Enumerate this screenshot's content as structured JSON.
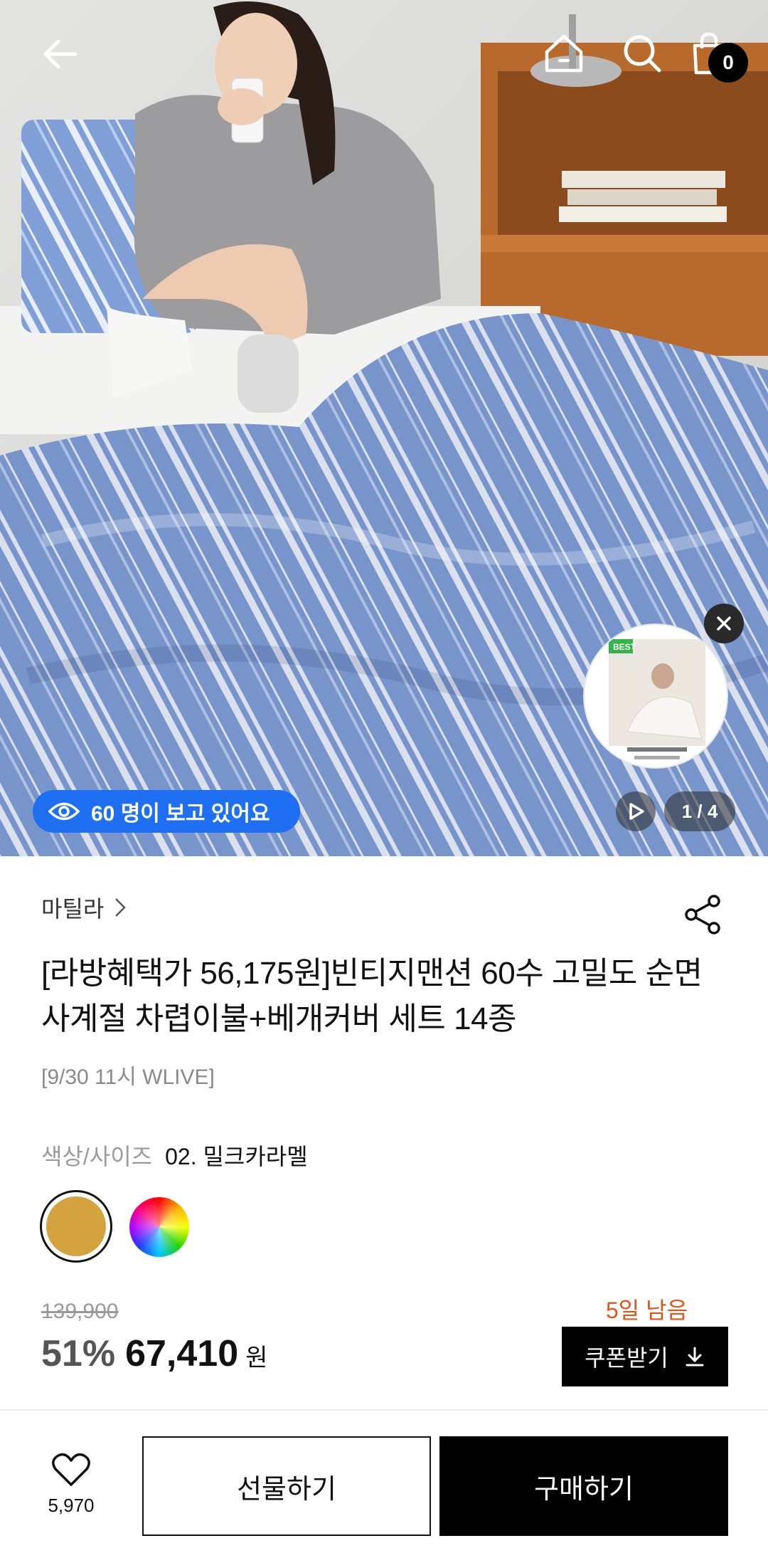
{
  "header": {
    "back_icon": "arrow-left-icon",
    "home_icon": "home-icon",
    "search_icon": "search-icon",
    "cart_icon": "shopping-bag-icon",
    "cart_count": "0"
  },
  "hero": {
    "viewers_text": "60 명이 보고 있어요",
    "viewers_icon": "eye-icon",
    "page_indicator": "1 / 4",
    "live_thumb_badge": "BEST",
    "accent_color": "#1f6ff2"
  },
  "product": {
    "brand": "마틸라",
    "title": "[라방혜택가 56,175원]빈티지맨션 60수 고밀도 순면 사계절 차렵이불+베개커버 세트 14종",
    "subtitle": "[9/30 11시 WLIVE]",
    "option_label": "색상/사이즈",
    "option_value": "02. 밀크카라멜",
    "swatch_selected_color": "#d4a23f",
    "original_price": "139,900",
    "discount": "51%",
    "sale_price": "67,410",
    "currency": "원",
    "days_left": "5일 남음",
    "coupon_label": "쿠폰받기"
  },
  "bottom": {
    "wish_count": "5,970",
    "gift_label": "선물하기",
    "buy_label": "구매하기"
  }
}
